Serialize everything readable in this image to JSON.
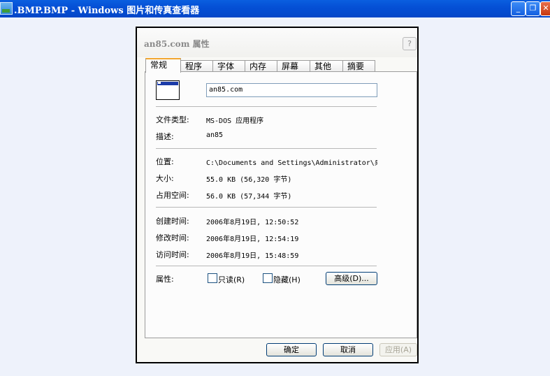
{
  "window": {
    "title": ".BMP.BMP - Windows 图片和传真查看器",
    "minimize_glyph": "_",
    "maximize_glyph": "❐",
    "close_glyph": "✕"
  },
  "dialog": {
    "title": "an85.com 属性",
    "help_glyph": "?",
    "tabs": [
      "常规",
      "程序",
      "字体",
      "内存",
      "屏幕",
      "其他",
      "摘要"
    ],
    "file_name": "an85.com",
    "rows": {
      "type_label": "文件类型:",
      "type_value": "MS-DOS 应用程序",
      "desc_label": "描述:",
      "desc_value": "an85",
      "location_label": "位置:",
      "location_value": "C:\\Documents and Settings\\Administrator\\桌",
      "size_label": "大小:",
      "size_value": "55.0 KB (56,320 字节)",
      "disk_label": "占用空间:",
      "disk_value": "56.0 KB (57,344 字节)",
      "created_label": "创建时间:",
      "created_value": "2006年8月19日, 12:50:52",
      "modified_label": "修改时间:",
      "modified_value": "2006年8月19日, 12:54:19",
      "accessed_label": "访问时间:",
      "accessed_value": "2006年8月19日, 15:48:59"
    },
    "attributes": {
      "label": "属性:",
      "readonly_label": "只读(R)",
      "hidden_label": "隐藏(H)",
      "advanced_label": "高级(D)..."
    },
    "buttons": {
      "ok": "确定",
      "cancel": "取消",
      "apply": "应用(A)"
    }
  },
  "colors": {
    "titlebar": "#0550d6",
    "tab_highlight": "#f2a630",
    "background": "#eef2fb"
  }
}
